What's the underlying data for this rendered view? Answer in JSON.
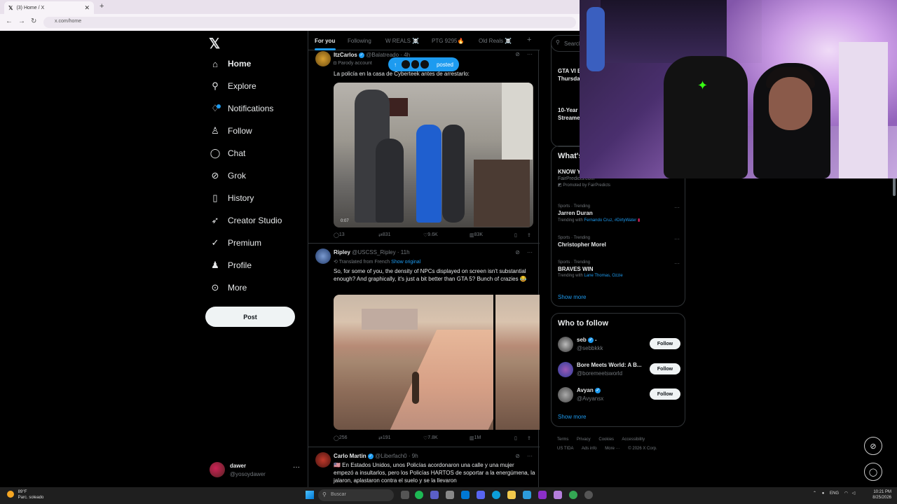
{
  "browser": {
    "tab_title": "(3) Home / X",
    "url": "x.com/home"
  },
  "nav": {
    "items": [
      {
        "label": "Home",
        "icon": "home-icon"
      },
      {
        "label": "Explore",
        "icon": "search-icon"
      },
      {
        "label": "Notifications",
        "icon": "bell-icon"
      },
      {
        "label": "Follow",
        "icon": "add-person-icon"
      },
      {
        "label": "Chat",
        "icon": "chat-icon"
      },
      {
        "label": "Grok",
        "icon": "grok-icon"
      },
      {
        "label": "History",
        "icon": "bookmark-icon"
      },
      {
        "label": "Creator Studio",
        "icon": "rocket-icon"
      },
      {
        "label": "Premium",
        "icon": "verified-icon"
      },
      {
        "label": "Profile",
        "icon": "person-icon"
      },
      {
        "label": "More",
        "icon": "more-circle-icon"
      }
    ],
    "post_label": "Post",
    "user_name": "dawer",
    "user_handle": "@yosoydawer"
  },
  "feed": {
    "tabs": [
      "For you",
      "Following",
      "W REALS ☠️",
      "PTG 9295🔥",
      "Old Reals ☠️"
    ],
    "posted_pill": "posted",
    "tweets": [
      {
        "name": "ItzCarlos",
        "handle": "@Balatreado",
        "time": "4h",
        "sub": "Parody account",
        "text": "La policía en la casa de Cyberteek antes de arrestarlo:",
        "video_time": "0:07",
        "replies": "13",
        "reposts": "831",
        "likes": "9.6K",
        "views": "83K"
      },
      {
        "name": "Ripley",
        "handle": "@USCSS_Ripley",
        "time": "11h",
        "sub": "Translated from French",
        "sub_link": "Show original",
        "text": "So, for some of you, the density of NPCs displayed on screen isn't substantial enough? And graphically, it's just a bit better than GTA 5? Bunch of crazies 😂",
        "replies": "256",
        "reposts": "191",
        "likes": "7.8K",
        "views": "1M"
      },
      {
        "name": "Carlo Martin",
        "handle": "@Liberfach0",
        "time": "9h",
        "text": "🇺🇸 En Estados Unidos, unos Policías acordonaron una calle y una mujer empezó a insultarlos, pero los Policías HARTOS de soportar a la energúmena, la jalaron, aplastaron contra el suelo y se la llevaron"
      }
    ]
  },
  "right": {
    "search_placeholder": "Search",
    "partial_items": [
      "GTA VI E",
      "Thursda",
      "10-Year",
      "Streame"
    ],
    "whats_heading": "What's",
    "promo_title": "KNOW Y",
    "promo_site": "FairPredicts.com",
    "promo_label": "Promoted by FairPredicts",
    "trends": [
      {
        "meta": "Sports · Trending",
        "title": "Jarren Duran",
        "with_prefix": "Trending with ",
        "with": "Fernando Cruz, #DirtyWater"
      },
      {
        "meta": "Sports · Trending",
        "title": "Christopher Morel"
      },
      {
        "meta": "Sports · Trending",
        "title": "BRAVES WIN",
        "with_prefix": "Trending with ",
        "with": "Lane Thomas, Ozzie"
      }
    ],
    "show_more": "Show more",
    "wtf_heading": "Who to follow",
    "follow_label": "Follow",
    "who_to_follow": [
      {
        "name": "seb",
        "handle": "@sebbkkk"
      },
      {
        "name": "Bore Meets World: A B...",
        "handle": "@boremeetsworld"
      },
      {
        "name": "Avyan",
        "handle": "@Avyansx"
      }
    ],
    "footer": [
      "Terms",
      "Privacy",
      "Cookies",
      "Accessibility",
      "US TIDA",
      "Ads info",
      "More ···",
      "© 2026 X Corp."
    ]
  },
  "taskbar": {
    "temp": "89°F",
    "weather": "Parc. soleado",
    "search": "Buscar",
    "lang": "ENG",
    "time": "10:21 PM",
    "date": "8/25/2026"
  }
}
